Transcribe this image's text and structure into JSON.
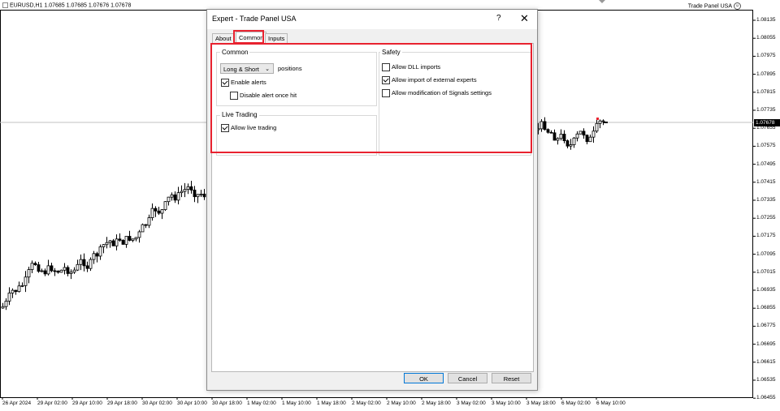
{
  "chart": {
    "symbol_line": "EURUSD,H1  1.07685 1.07685 1.07676 1.07678",
    "expert_label": "Trade Panel USA",
    "current_price": "1.07678",
    "y_ticks": [
      "1.08135",
      "1.08055",
      "1.07975",
      "1.07895",
      "1.07815",
      "1.07735",
      "1.07655",
      "1.07575",
      "1.07495",
      "1.07415",
      "1.07335",
      "1.07255",
      "1.07175",
      "1.07095",
      "1.07015",
      "1.06935",
      "1.06855",
      "1.06775",
      "1.06695",
      "1.06615",
      "1.06535",
      "1.06455"
    ],
    "x_ticks": [
      "26 Apr 2024",
      "29 Apr 02:00",
      "29 Apr 10:00",
      "29 Apr 18:00",
      "30 Apr 02:00",
      "30 Apr 10:00",
      "30 Apr 18:00",
      "1 May 02:00",
      "1 May 10:00",
      "1 May 18:00",
      "2 May 02:00",
      "2 May 10:00",
      "2 May 18:00",
      "3 May 02:00",
      "3 May 10:00",
      "3 May 18:00",
      "6 May 02:00",
      "6 May 10:00"
    ],
    "colors": {
      "candle": "#000000",
      "accent": "#e8222f"
    }
  },
  "dialog": {
    "title": "Expert - Trade Panel USA",
    "help_glyph": "?",
    "close_glyph": "✕",
    "tabs": [
      {
        "label": "About",
        "active": false
      },
      {
        "label": "Common",
        "active": true
      },
      {
        "label": "Inputs",
        "active": false
      }
    ],
    "common": {
      "group_label": "Common",
      "positions_select": "Long & Short",
      "positions_label": "positions",
      "enable_alerts": {
        "label": "Enable alerts",
        "checked": true
      },
      "disable_alert_once_hit": {
        "label": "Disable alert once hit",
        "checked": false
      }
    },
    "live_trading": {
      "group_label": "Live Trading",
      "allow_live_trading": {
        "label": "Allow live trading",
        "checked": true
      }
    },
    "safety": {
      "group_label": "Safety",
      "allow_dll_imports": {
        "label": "Allow DLL imports",
        "checked": false
      },
      "allow_external_experts": {
        "label": "Allow import of external experts",
        "checked": true
      },
      "allow_signals_modification": {
        "label": "Allow modification of Signals settings",
        "checked": false
      }
    },
    "buttons": {
      "ok": "OK",
      "cancel": "Cancel",
      "reset": "Reset"
    }
  }
}
